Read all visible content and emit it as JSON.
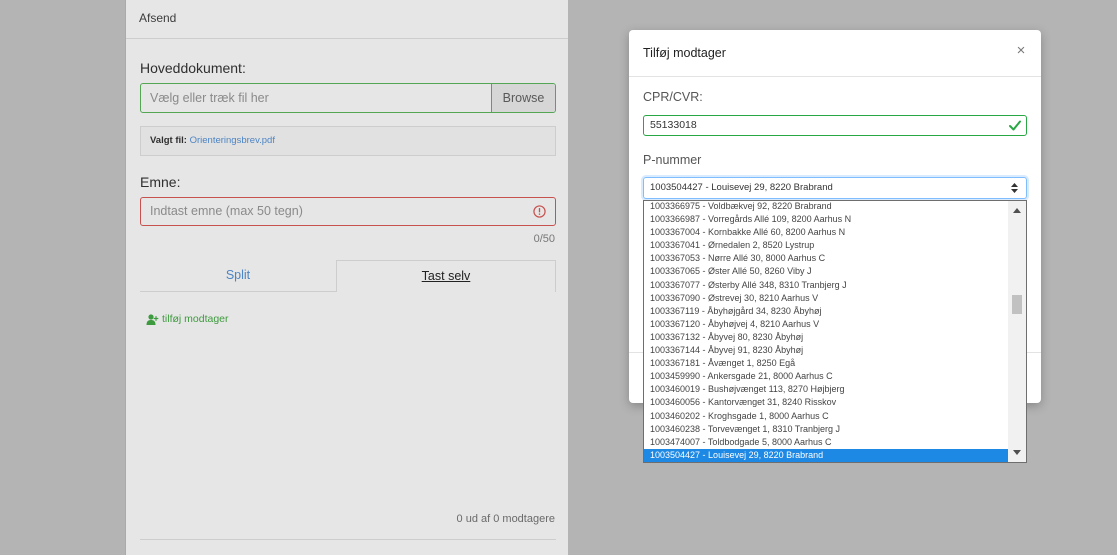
{
  "page": {
    "tab_label": "Afsend"
  },
  "form": {
    "main_doc_label": "Hoveddokument:",
    "file_input_placeholder": "Vælg eller træk fil her",
    "browse_label": "Browse",
    "selected_file_label": "Valgt fil:",
    "selected_file_name": "Orienteringsbrev.pdf",
    "subject_label": "Emne:",
    "subject_placeholder": "Indtast emne (max 50 tegn)",
    "subject_counter": "0/50",
    "tabs": [
      {
        "label": "Split",
        "active": false
      },
      {
        "label": "Tast selv",
        "active": true
      }
    ],
    "add_recipient_label": "tilføj modtager",
    "recipient_count": "0 ud af 0 modtagere"
  },
  "modal": {
    "title": "Tilføj modtager",
    "close_label": "×",
    "cpr_label": "CPR/CVR:",
    "cpr_value": "55133018",
    "p_label": "P-nummer",
    "p_selected": "1003504427 - Louisevej 29, 8220 Brabrand",
    "p_options": [
      "1003366975 - Voldbækvej 92, 8220 Brabrand",
      "1003366987 - Vorregårds Allé 109, 8200 Aarhus N",
      "1003367004 - Kornbakke Allé 60, 8200 Aarhus N",
      "1003367041 - Ørnedalen 2, 8520 Lystrup",
      "1003367053 - Nørre Allé 30, 8000 Aarhus C",
      "1003367065 - Øster Allé 50, 8260 Viby J",
      "1003367077 - Østerby Allé 348, 8310 Tranbjerg J",
      "1003367090 - Østrevej 30, 8210 Aarhus V",
      "1003367119 - Åbyhøjgård 34, 8230 Åbyhøj",
      "1003367120 - Åbyhøjvej 4, 8210 Aarhus V",
      "1003367132 - Åbyvej 80, 8230 Åbyhøj",
      "1003367144 - Åbyvej 91, 8230 Åbyhøj",
      "1003367181 - Åvænget 1, 8250 Egå",
      "1003459990 - Ankersgade 21, 8000 Aarhus C",
      "1003460019 - Bushøjvænget 113, 8270 Højbjerg",
      "1003460056 - Kantorvænget 31, 8240 Risskov",
      "1003460202 - Kroghsgade 1, 8000 Aarhus C",
      "1003460238 - Torvevænget 1, 8310 Tranbjerg J",
      "1003474007 - Toldbodgade 5, 8000 Aarhus C",
      "1003504427 - Louisevej 29, 8220 Brabrand"
    ],
    "highlighted_option_index": 19
  },
  "icons": {
    "add_recipient": "user-plus-icon",
    "subject_error": "exclamation-circle-icon",
    "cpr_valid": "check-icon",
    "select_arrows": "sort-icon",
    "scroll_up": "scroll-up-arrow-icon",
    "scroll_down": "scroll-down-arrow-icon"
  },
  "colors": {
    "success": "#28a745",
    "success_dim": "#54a554",
    "danger_dim": "#c7514e",
    "link_dim": "#4c84c4",
    "focus": "#80bdff",
    "highlight": "#1e88e5"
  }
}
